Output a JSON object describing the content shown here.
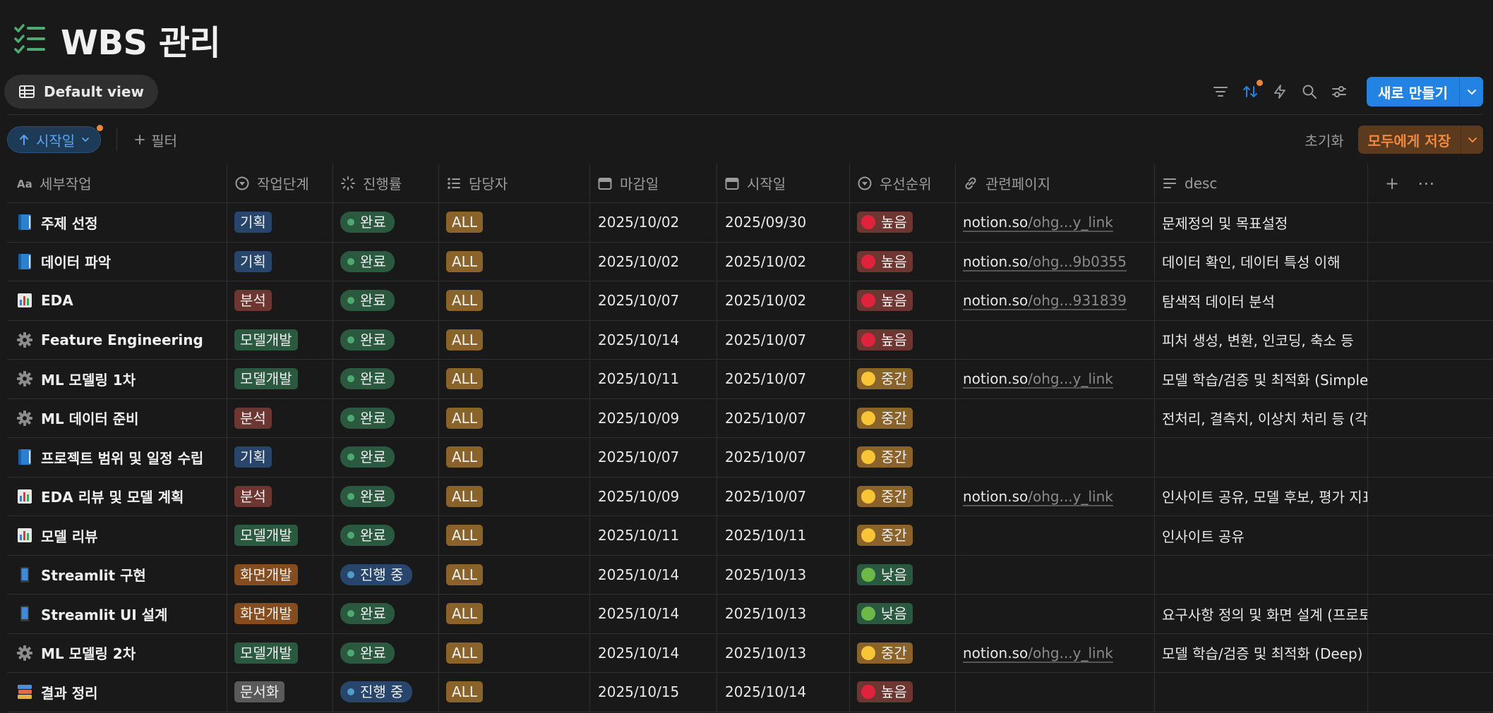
{
  "title": "WBS 관리",
  "view": {
    "tab_label": "Default view"
  },
  "toolbar": {
    "new_label": "새로 만들기"
  },
  "filterbar": {
    "sort_label": "시작일",
    "filter_label": "필터",
    "reset_label": "초기화",
    "save_label": "모두에게 저장"
  },
  "columns": [
    "세부작업",
    "작업단계",
    "진행률",
    "담당자",
    "마감일",
    "시작일",
    "우선순위",
    "관련페이지",
    "desc"
  ],
  "rows": [
    {
      "icon": "book",
      "task": "주제 선정",
      "stage": "기획",
      "stage_color": "blue",
      "status": "완료",
      "status_kind": "done",
      "owner": "ALL",
      "due": "2025/10/02",
      "start": "2025/09/30",
      "priority": "높음",
      "prio_kind": "high",
      "link_host": "notion.so",
      "link_path": "/ohg...y_link",
      "desc": "문제정의 및 목표설정"
    },
    {
      "icon": "book",
      "task": "데이터 파악",
      "stage": "기획",
      "stage_color": "blue",
      "status": "완료",
      "status_kind": "done",
      "owner": "ALL",
      "due": "2025/10/02",
      "start": "2025/10/02",
      "priority": "높음",
      "prio_kind": "high",
      "link_host": "notion.so",
      "link_path": "/ohg...9b0355",
      "desc": "데이터 확인, 데이터 특성 이해"
    },
    {
      "icon": "chart",
      "task": "EDA",
      "stage": "분석",
      "stage_color": "red",
      "status": "완료",
      "status_kind": "done",
      "owner": "ALL",
      "due": "2025/10/07",
      "start": "2025/10/02",
      "priority": "높음",
      "prio_kind": "high",
      "link_host": "notion.so",
      "link_path": "/ohg...931839",
      "desc": "탐색적 데이터 분석"
    },
    {
      "icon": "gear",
      "task": "Feature Engineering",
      "stage": "모델개발",
      "stage_color": "green",
      "status": "완료",
      "status_kind": "done",
      "owner": "ALL",
      "due": "2025/10/14",
      "start": "2025/10/07",
      "priority": "높음",
      "prio_kind": "high",
      "link_host": "",
      "link_path": "",
      "desc": "피처 생성, 변환, 인코딩, 축소 등"
    },
    {
      "icon": "gear",
      "task": "ML 모델링 1차",
      "stage": "모델개발",
      "stage_color": "green",
      "status": "완료",
      "status_kind": "done",
      "owner": "ALL",
      "due": "2025/10/11",
      "start": "2025/10/07",
      "priority": "중간",
      "prio_kind": "mid",
      "link_host": "notion.so",
      "link_path": "/ohg...y_link",
      "desc": "모델 학습/검증 및 최적화 (Simple"
    },
    {
      "icon": "gear",
      "task": "ML 데이터 준비",
      "stage": "분석",
      "stage_color": "red",
      "status": "완료",
      "status_kind": "done",
      "owner": "ALL",
      "due": "2025/10/09",
      "start": "2025/10/07",
      "priority": "중간",
      "prio_kind": "mid",
      "link_host": "",
      "link_path": "",
      "desc": "전처리, 결측치, 이상치 처리 등 (각"
    },
    {
      "icon": "book",
      "task": "프로젝트 범위 및 일정 수립",
      "stage": "기획",
      "stage_color": "blue",
      "status": "완료",
      "status_kind": "done",
      "owner": "ALL",
      "due": "2025/10/07",
      "start": "2025/10/07",
      "priority": "중간",
      "prio_kind": "mid",
      "link_host": "",
      "link_path": "",
      "desc": ""
    },
    {
      "icon": "chart",
      "task": "EDA 리뷰 및 모델 계획",
      "stage": "분석",
      "stage_color": "red",
      "status": "완료",
      "status_kind": "done",
      "owner": "ALL",
      "due": "2025/10/09",
      "start": "2025/10/07",
      "priority": "중간",
      "prio_kind": "mid",
      "link_host": "notion.so",
      "link_path": "/ohg...y_link",
      "desc": "인사이트 공유, 모델 후보, 평가 지표"
    },
    {
      "icon": "chart",
      "task": "모델 리뷰",
      "stage": "모델개발",
      "stage_color": "green",
      "status": "완료",
      "status_kind": "done",
      "owner": "ALL",
      "due": "2025/10/11",
      "start": "2025/10/11",
      "priority": "중간",
      "prio_kind": "mid",
      "link_host": "",
      "link_path": "",
      "desc": "인사이트 공유"
    },
    {
      "icon": "phone",
      "task": "Streamlit 구현",
      "stage": "화면개발",
      "stage_color": "orange",
      "status": "진행 중",
      "status_kind": "prog",
      "owner": "ALL",
      "due": "2025/10/14",
      "start": "2025/10/13",
      "priority": "낮음",
      "prio_kind": "low",
      "link_host": "",
      "link_path": "",
      "desc": ""
    },
    {
      "icon": "phone",
      "task": "Streamlit UI 설계",
      "stage": "화면개발",
      "stage_color": "orange",
      "status": "완료",
      "status_kind": "done",
      "owner": "ALL",
      "due": "2025/10/14",
      "start": "2025/10/13",
      "priority": "낮음",
      "prio_kind": "low",
      "link_host": "",
      "link_path": "",
      "desc": "요구사항 정의 및 화면 설계 (프로토"
    },
    {
      "icon": "gear",
      "task": "ML 모델링 2차",
      "stage": "모델개발",
      "stage_color": "green",
      "status": "완료",
      "status_kind": "done",
      "owner": "ALL",
      "due": "2025/10/14",
      "start": "2025/10/13",
      "priority": "중간",
      "prio_kind": "mid",
      "link_host": "notion.so",
      "link_path": "/ohg...y_link",
      "desc": "모델 학습/검증 및 최적화 (Deep)"
    },
    {
      "icon": "books",
      "task": "결과 정리",
      "stage": "문서화",
      "stage_color": "gray",
      "status": "진행 중",
      "status_kind": "prog",
      "owner": "ALL",
      "due": "2025/10/15",
      "start": "2025/10/14",
      "priority": "높음",
      "prio_kind": "high",
      "link_host": "",
      "link_path": "",
      "desc": ""
    }
  ]
}
